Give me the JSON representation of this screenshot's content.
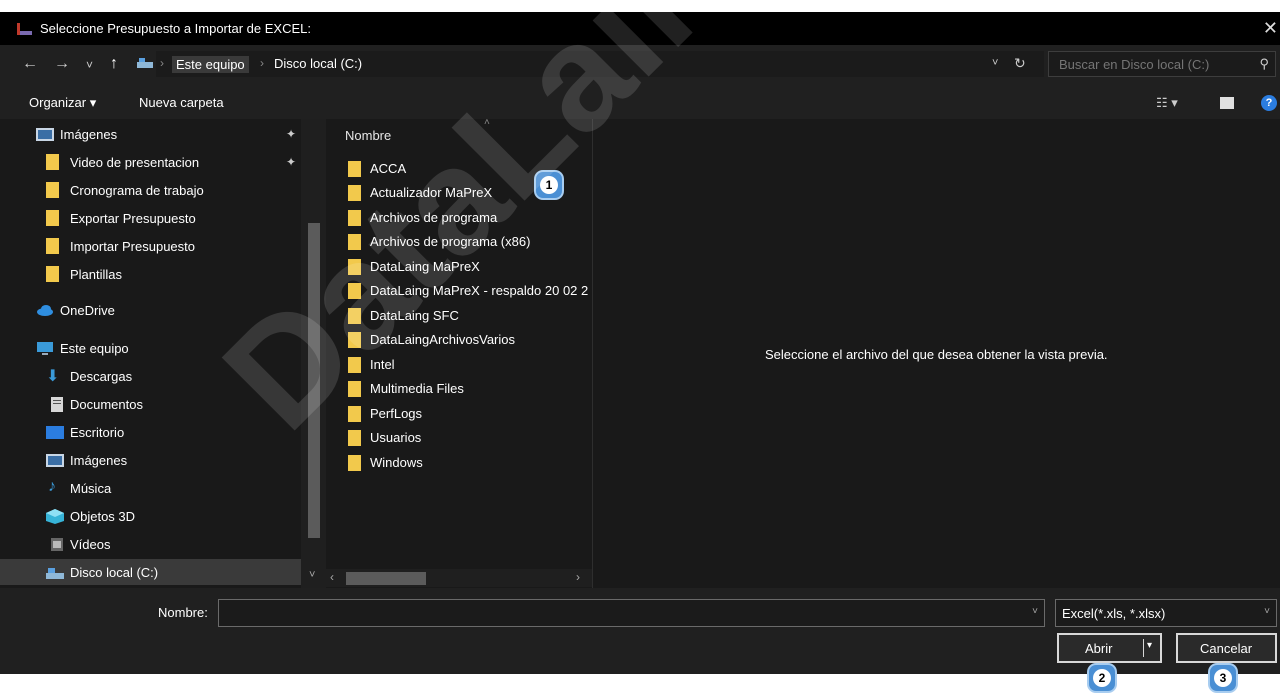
{
  "window": {
    "title": "Seleccione Presupuesto a Importar de EXCEL:",
    "close_glyph": "✕"
  },
  "nav": {
    "back": "←",
    "forward": "→",
    "recent": "˅",
    "up": "↑",
    "breadcrumb": [
      "Este equipo",
      "Disco local (C:)"
    ],
    "search_placeholder": "Buscar en Disco local (C:)"
  },
  "toolbar": {
    "organize": "Organizar ▾",
    "new_folder": "Nueva carpeta"
  },
  "sidebar": {
    "items": [
      {
        "label": "Imágenes",
        "icon": "pictures-icon",
        "pinned": true
      },
      {
        "label": "Video de presentacion",
        "icon": "folder-icon",
        "pinned": true
      },
      {
        "label": "Cronograma de trabajo",
        "icon": "folder-icon"
      },
      {
        "label": "Exportar Presupuesto",
        "icon": "folder-icon"
      },
      {
        "label": "Importar Presupuesto",
        "icon": "folder-icon"
      },
      {
        "label": "Plantillas",
        "icon": "folder-icon"
      },
      {
        "label": "OneDrive",
        "icon": "onedrive-icon"
      },
      {
        "label": "Este equipo",
        "icon": "pc-icon"
      },
      {
        "label": "Descargas",
        "icon": "download-icon"
      },
      {
        "label": "Documentos",
        "icon": "documents-icon"
      },
      {
        "label": "Escritorio",
        "icon": "desktop-icon"
      },
      {
        "label": "Imágenes",
        "icon": "pictures-icon"
      },
      {
        "label": "Música",
        "icon": "music-icon"
      },
      {
        "label": "Objetos 3D",
        "icon": "objects3d-icon"
      },
      {
        "label": "Vídeos",
        "icon": "videos-icon"
      },
      {
        "label": "Disco local (C:)",
        "icon": "drive-icon",
        "selected": true
      }
    ]
  },
  "files": {
    "column_header": "Nombre",
    "items": [
      "ACCA",
      "Actualizador MaPreX",
      "Archivos de programa",
      "Archivos de programa (x86)",
      "DataLaing MaPreX",
      "DataLaing MaPreX - respaldo 20 02 2",
      "DataLaing SFC",
      "DataLaingArchivosVarios",
      "Intel",
      "Multimedia Files",
      "PerfLogs",
      "Usuarios",
      "Windows"
    ]
  },
  "preview": {
    "message": "Seleccione el archivo del que desea obtener la vista previa."
  },
  "bottom": {
    "filename_label": "Nombre:",
    "filename_value": "",
    "filetype": "Excel(*.xls, *.xlsx)",
    "open": "Abrir",
    "cancel": "Cancelar"
  },
  "badges": [
    "1",
    "2",
    "3"
  ],
  "watermark": "DataLaing",
  "colors": {
    "folder": "#f2c94c",
    "badge": "#4a8fd4",
    "background": "#191919"
  }
}
